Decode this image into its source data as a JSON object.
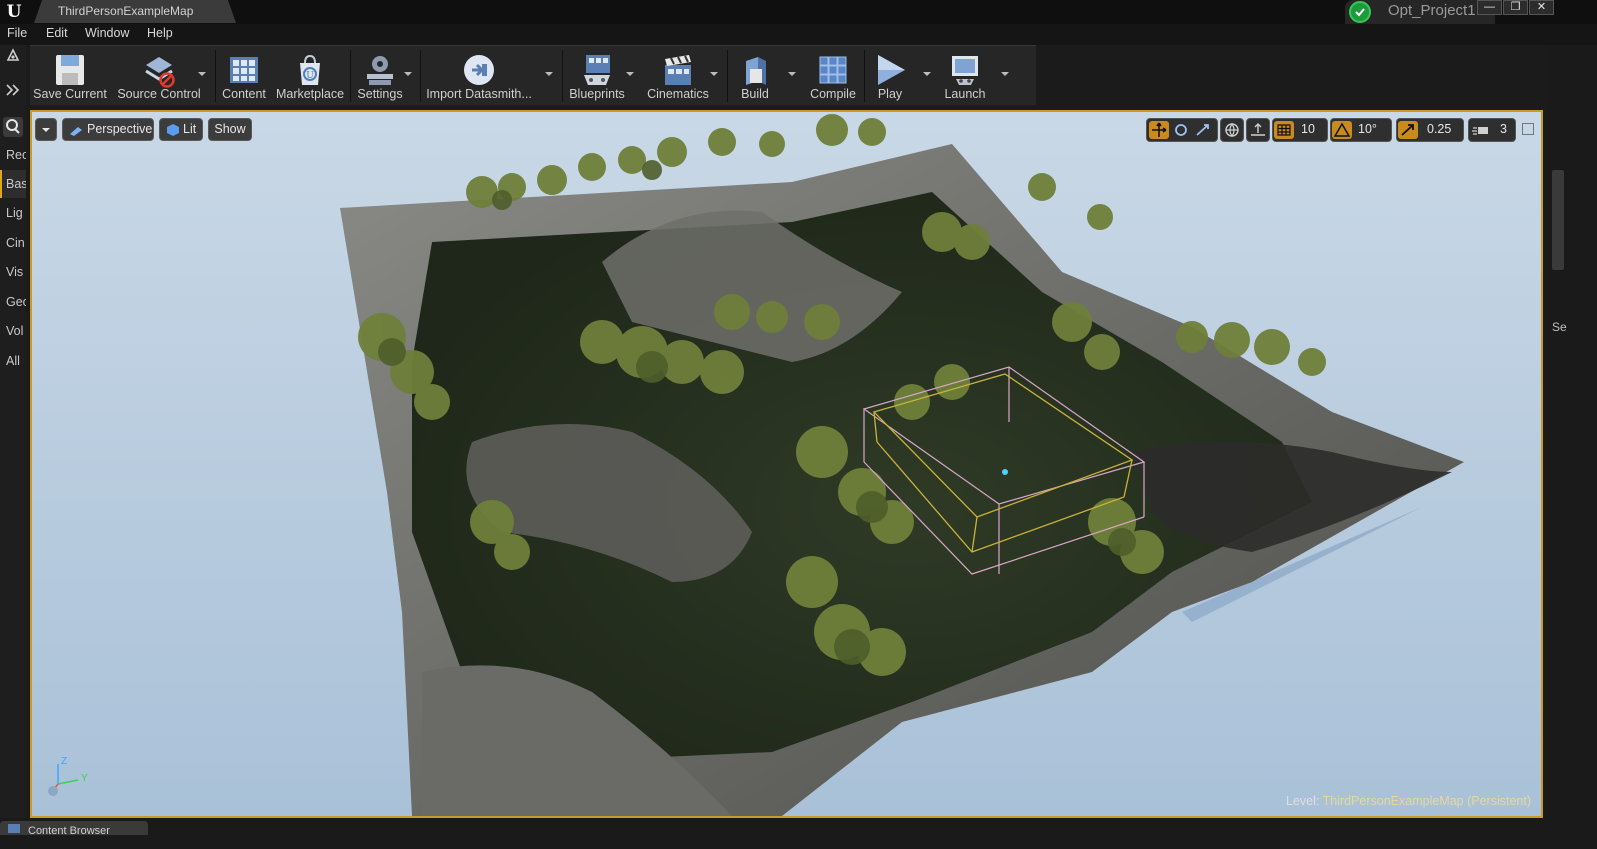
{
  "window": {
    "tab_title": "ThirdPersonExampleMap",
    "project_name": "Opt_Project1",
    "controls": {
      "minimize": "—",
      "restore": "❐",
      "close": "✕"
    }
  },
  "menu": [
    "File",
    "Edit",
    "Window",
    "Help"
  ],
  "toolbar": {
    "save_current": "Save Current",
    "source_control": "Source Control",
    "content": "Content",
    "marketplace": "Marketplace",
    "settings": "Settings",
    "import_datasmith": "Import Datasmith...",
    "blueprints": "Blueprints",
    "cinematics": "Cinematics",
    "build": "Build",
    "compile": "Compile",
    "play": "Play",
    "launch": "Launch"
  },
  "left_panel": {
    "items": [
      "Rec",
      "Bas",
      "Lig",
      "Cin",
      "Vis",
      "Geo",
      "Vol",
      "All"
    ],
    "active_index": 1
  },
  "right_panel": {
    "label": "Se"
  },
  "viewport": {
    "perspective_label": "Perspective",
    "lit_label": "Lit",
    "show_label": "Show",
    "grid_snap": "10",
    "rotation_snap": "10°",
    "scale_snap": "0.25",
    "camera_speed": "3",
    "level_label": "Level:",
    "level_name": "ThirdPersonExampleMap (Persistent)",
    "axis_labels": {
      "z": "Z",
      "y": "Y"
    }
  },
  "bottom": {
    "content_browser_tab": "Content Browser"
  },
  "colors": {
    "accent": "#c99b26",
    "viewport_border": "#c99b26",
    "sky": "#bfd0e0"
  }
}
